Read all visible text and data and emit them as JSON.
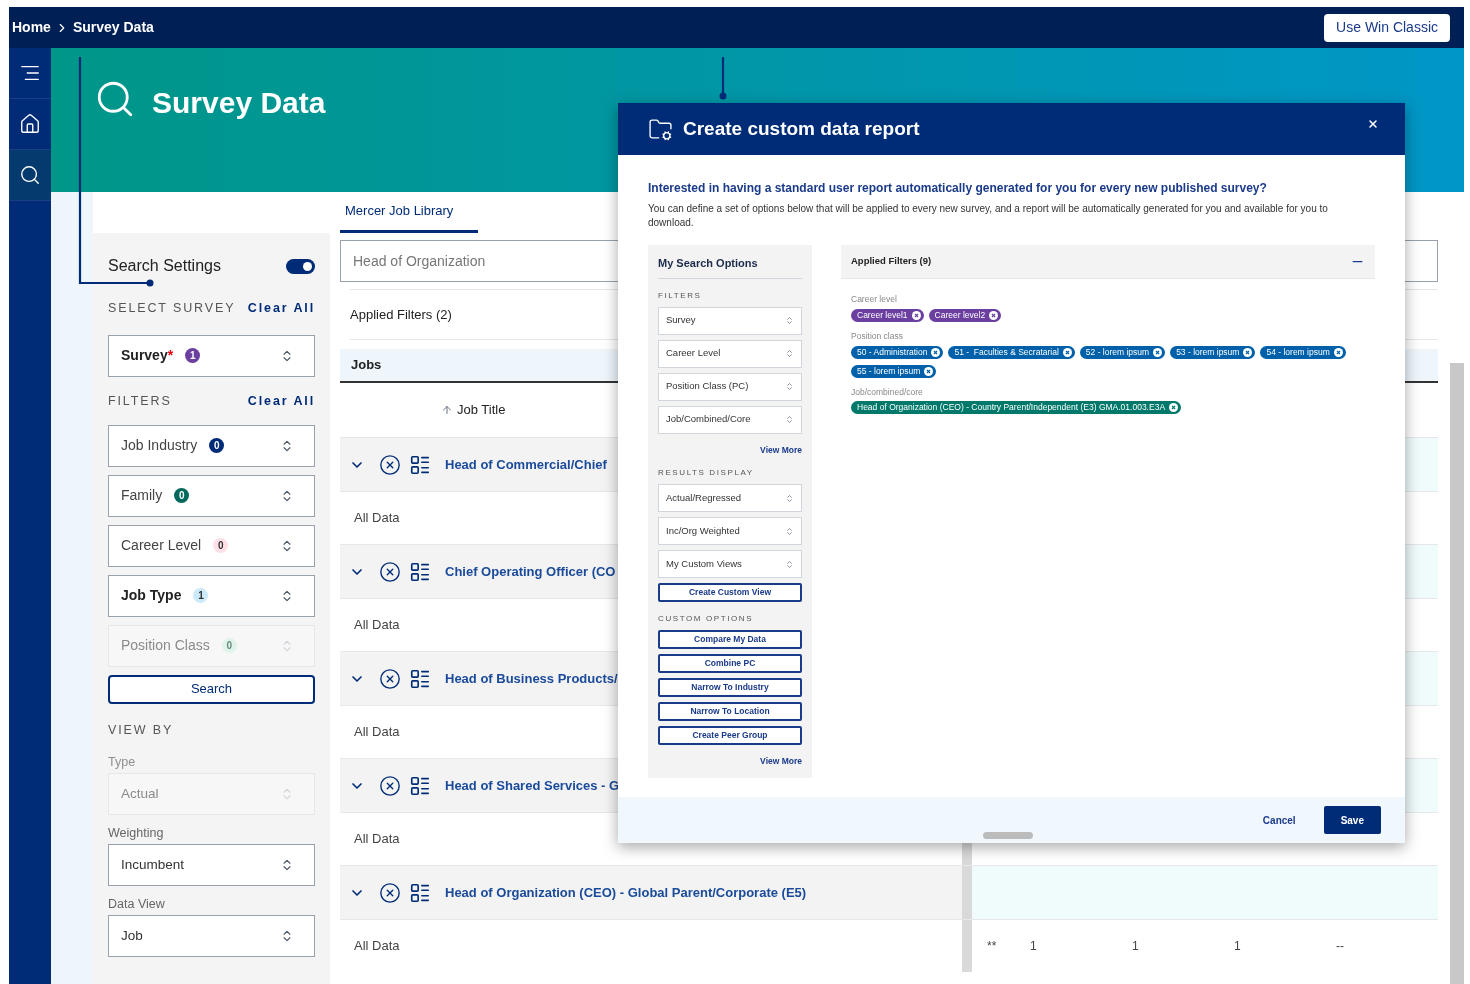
{
  "breadcrumb": [
    {
      "label": "Home"
    },
    {
      "label": "Survey Data"
    }
  ],
  "header_button": "Use Win Classic",
  "rail": [
    {
      "kind": "menu",
      "selected": false
    },
    {
      "kind": "home",
      "selected": false
    },
    {
      "kind": "search",
      "selected": true
    }
  ],
  "page_title": "Survey Data",
  "tabs": [
    {
      "label": "Mercer Job Library",
      "selected": true
    }
  ],
  "settings": {
    "title": "Search Settings",
    "on": true,
    "survey_heading": "SELECT SURVEY",
    "survey_clear": "Clear All",
    "survey_field": {
      "label": "Survey",
      "mark": "*",
      "count": "1",
      "color": "#6b3fa0",
      "kind": "solid",
      "active": true,
      "disabled": false
    },
    "filters_heading": "FILTERS",
    "filters_clear": "Clear All",
    "filters": [
      {
        "label": "Job Industry",
        "count": "0",
        "color": "#002c77",
        "kind": "solid",
        "active": false,
        "disabled": false
      },
      {
        "label": "Family",
        "count": "0",
        "color": "#00695c",
        "kind": "solid",
        "active": false,
        "disabled": false
      },
      {
        "label": "Career Level",
        "count": "0",
        "color": "#fde1e6",
        "kind": "soft",
        "active": false,
        "disabled": false
      },
      {
        "label": "Job Type",
        "count": "1",
        "color": "#cdeafa",
        "kind": "soft",
        "active": true,
        "disabled": false
      },
      {
        "label": "Position Class",
        "count": "0",
        "color": "#dff3ea",
        "kind": "soft",
        "active": false,
        "disabled": true
      }
    ],
    "search_button": "Search",
    "view_heading": "VIEW BY",
    "view_fields": [
      {
        "label": "Type",
        "value": "Actual",
        "disabled": true
      },
      {
        "label": "Weighting",
        "value": "Incumbent",
        "disabled": false
      },
      {
        "label": "Data View",
        "value": "Job",
        "disabled": false
      }
    ]
  },
  "search": {
    "placeholder": "Head of Organization"
  },
  "applied_filters": "Applied Filters (2)",
  "table": {
    "title": "Jobs",
    "column": {
      "label": "Job Title",
      "sorted_ascending": true
    },
    "rows": [
      {
        "title": "Head of Commercial/Chief",
        "expanded": true,
        "sub": "All Data"
      },
      {
        "title": "Chief Operating Officer (CO",
        "expanded": true,
        "sub": "All Data"
      },
      {
        "title": "Head of Business Products/",
        "expanded": true,
        "sub": "All Data"
      },
      {
        "title": "Head of Shared Services - G",
        "expanded": true,
        "sub": "All Data"
      },
      {
        "title": "Head of Organization (CEO) - Global Parent/Corporate (E5)",
        "expanded": true,
        "sub": "All Data",
        "values": [
          "**",
          "1",
          "1",
          "1",
          "--"
        ]
      }
    ]
  },
  "modal": {
    "title": "Create custom data report",
    "heading": "Interested in having a standard user report automatically generated for you for every new published survey?",
    "description": "You can define a set of options below that will be applied to every new survey, and a report will be automatically generated for you and available for you to download.",
    "options": {
      "title": "My Search Options",
      "sections": [
        {
          "heading": "FILTERS",
          "selects": [
            "Survey",
            "Career Level",
            "Position Class (PC)",
            "Job/Combined/Core"
          ],
          "more": "View More"
        },
        {
          "heading": "RESULTS DISPLAY",
          "selects": [
            "Actual/Regressed",
            "Inc/Org Weighted",
            "My Custom Views"
          ],
          "buttons": [
            "Create Custom View"
          ]
        },
        {
          "heading": "CUSTOM OPTIONS",
          "buttons": [
            "Compare My Data",
            "Combine PC",
            "Narrow To Industry",
            "Narrow To Location",
            "Create Peer Group"
          ],
          "more": "View More"
        }
      ]
    },
    "applied": {
      "title": "Applied Filters (9)",
      "expanded": true,
      "groups": [
        {
          "label": "Career level",
          "chips": [
            {
              "label": "Career level1",
              "color": "#6b3fa0"
            },
            {
              "label": "Career level2",
              "color": "#6b3fa0"
            }
          ]
        },
        {
          "label": "Position class",
          "chips": [
            {
              "label": "50 - Administration",
              "color": "#0061aa"
            },
            {
              "label": "51 -  Faculties & Secratarial",
              "color": "#0061aa"
            },
            {
              "label": "52 - lorem ipsum",
              "color": "#0061aa"
            },
            {
              "label": "53 - lorem ipsum",
              "color": "#0061aa"
            },
            {
              "label": "54 - lorem ipsum",
              "color": "#0061aa"
            },
            {
              "label": "55 - lorem ipsum",
              "color": "#0061aa"
            }
          ]
        },
        {
          "label": "Job/combined/core",
          "chips": [
            {
              "label": "Head of Organization (CEO) - Country Parent/Independent (E3) GMA.01.003.E3A",
              "color": "#00796b"
            }
          ]
        }
      ]
    },
    "cancel": "Cancel",
    "save": "Save"
  }
}
